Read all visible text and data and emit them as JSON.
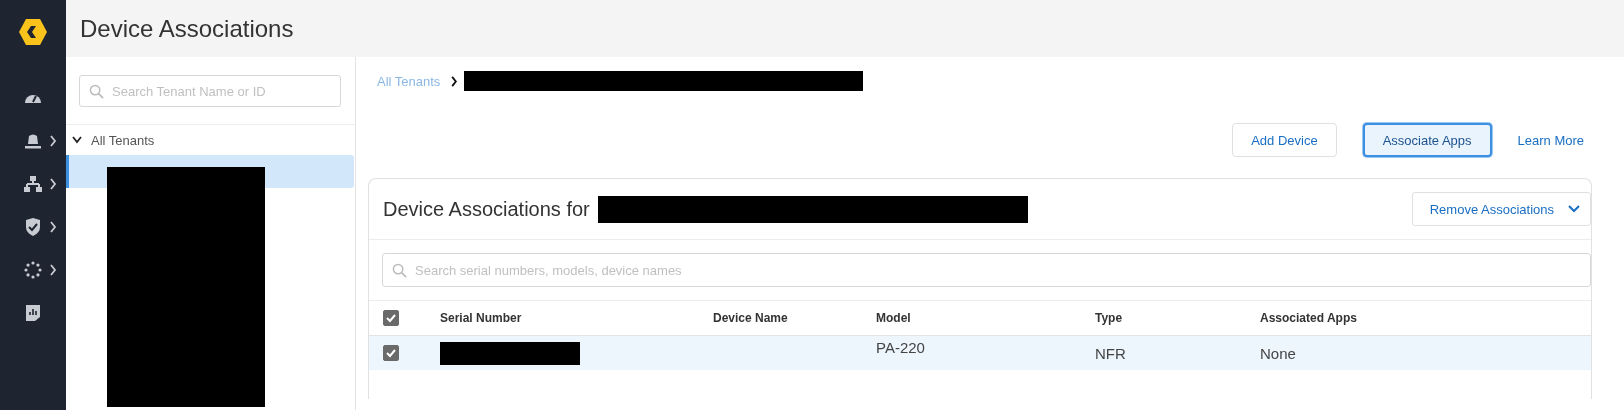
{
  "header": {
    "title": "Device Associations"
  },
  "nav_items": [
    {
      "has_submenu": false
    },
    {
      "has_submenu": true
    },
    {
      "has_submenu": true
    },
    {
      "has_submenu": true
    },
    {
      "has_submenu": true
    },
    {
      "has_submenu": false
    }
  ],
  "tenant_panel": {
    "search": {
      "placeholder": "Search Tenant Name or ID"
    },
    "root": {
      "label": "All Tenants",
      "expanded": true,
      "children": [
        {
          "selected": true
        }
      ]
    }
  },
  "breadcrumb": [
    {
      "label": "All Tenants"
    }
  ],
  "actions": [
    {
      "label": "Add Device",
      "kind": "button",
      "selected": false
    },
    {
      "label": "Associate Apps",
      "kind": "button",
      "selected": true
    },
    {
      "label": "Learn More",
      "kind": "link",
      "selected": false
    }
  ],
  "card": {
    "title": "Device Associations for",
    "menu_button": "Remove Associations",
    "search": {
      "placeholder": "Search serial numbers, models, device names"
    },
    "table": {
      "select_all_checked": true,
      "columns": [
        "Serial Number",
        "Device Name",
        "Model",
        "Type",
        "Associated Apps"
      ],
      "rows": [
        {
          "checked": true,
          "selected": true,
          "device_name": "",
          "model": "PA-220",
          "type": "NFR",
          "associated_apps": "None"
        }
      ]
    }
  }
}
